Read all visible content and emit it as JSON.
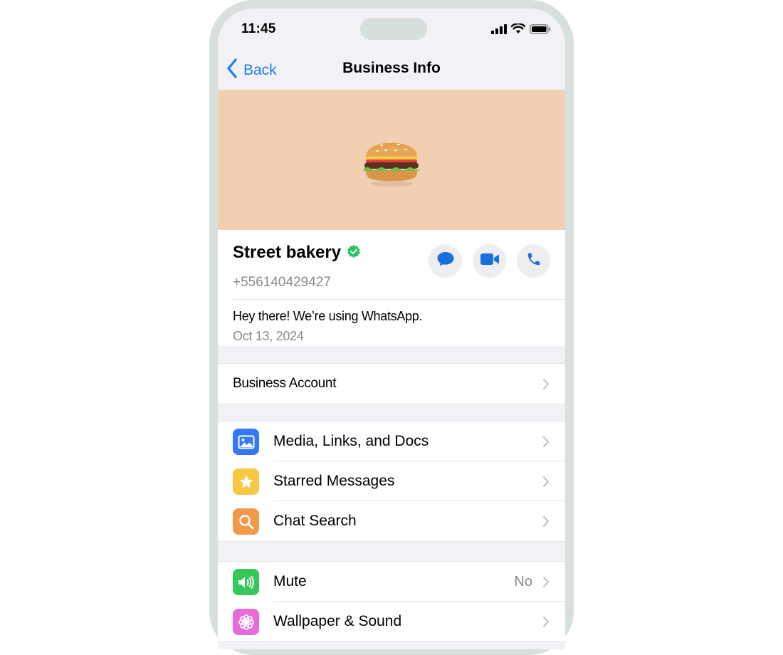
{
  "status_bar": {
    "time": "11:45"
  },
  "nav": {
    "back_label": "Back",
    "title": "Business Info"
  },
  "cover": {
    "emoji": "🍔"
  },
  "profile": {
    "name": "Street bakery",
    "phone": "+556140429427",
    "about": "Hey there! We’re using WhatsApp.",
    "about_date": "Oct 13, 2024"
  },
  "business_account": {
    "label": "Business Account"
  },
  "media_group": [
    {
      "label": "Media, Links, and Docs",
      "icon": "photo-icon",
      "color": "#3478f6"
    },
    {
      "label": "Starred Messages",
      "icon": "star-icon",
      "color": "#f6c843"
    },
    {
      "label": "Chat Search",
      "icon": "search-icon",
      "color": "#f2994a"
    }
  ],
  "settings_group": [
    {
      "label": "Mute",
      "value": "No",
      "icon": "speaker-icon",
      "color": "#34c759"
    },
    {
      "label": "Wallpaper & Sound",
      "icon": "flower-icon",
      "color": "#e96bd9"
    }
  ],
  "colors": {
    "accent": "#1a7ef5",
    "verified": "#25c75a",
    "cover": "#f3cfb2"
  }
}
